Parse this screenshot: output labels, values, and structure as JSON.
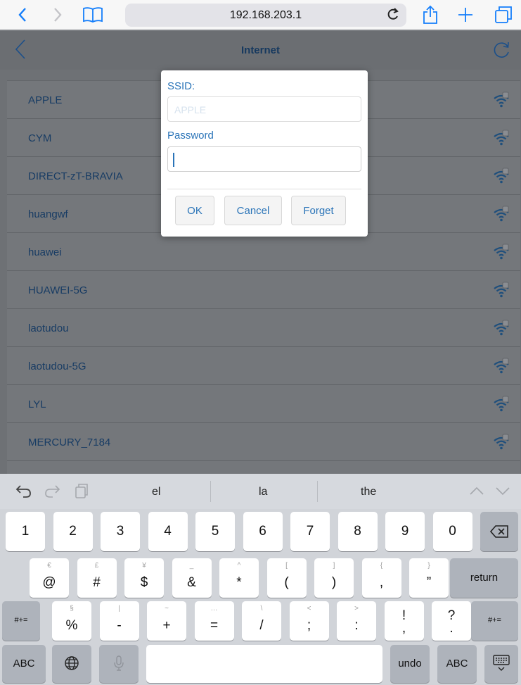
{
  "browser": {
    "url": "192.168.203.1"
  },
  "header": {
    "title": "Internet"
  },
  "networks": [
    "APPLE",
    "CYM",
    "DIRECT-zT-BRAVIA",
    "huangwf",
    "huawei",
    "HUAWEI-5G",
    "laotudou",
    "laotudou-5G",
    "LYL",
    "MERCURY_7184"
  ],
  "dialog": {
    "ssid_label": "SSID:",
    "ssid_value": "APPLE",
    "password_label": "Password",
    "password_value": "",
    "ok_label": "OK",
    "cancel_label": "Cancel",
    "forget_label": "Forget"
  },
  "keyboard": {
    "suggestions": [
      "el",
      "la",
      "the"
    ],
    "digits": [
      "1",
      "2",
      "3",
      "4",
      "5",
      "6",
      "7",
      "8",
      "9",
      "0"
    ],
    "row2_main": [
      "@",
      "#",
      "$",
      "&",
      "*",
      "(",
      ")",
      ",",
      "”"
    ],
    "row2_alt": [
      "€",
      "£",
      "¥",
      "_",
      "^",
      "[",
      "]",
      "{",
      "}"
    ],
    "row3_main": [
      "%",
      "-",
      "+",
      "=",
      "/",
      ";",
      ":",
      "!",
      "?"
    ],
    "row3_alt": [
      "§",
      "|",
      "~",
      "…",
      "\\",
      "<",
      ">",
      "",
      ""
    ],
    "row3_sub": [
      "",
      "",
      "",
      "",
      "",
      "",
      "",
      ",",
      "."
    ],
    "return_label": "return",
    "symbols_label": "#+=",
    "abc_label": "ABC",
    "undo_label": "undo"
  },
  "colors": {
    "accent": "#2a74b8",
    "ios_blue": "#147efb"
  }
}
